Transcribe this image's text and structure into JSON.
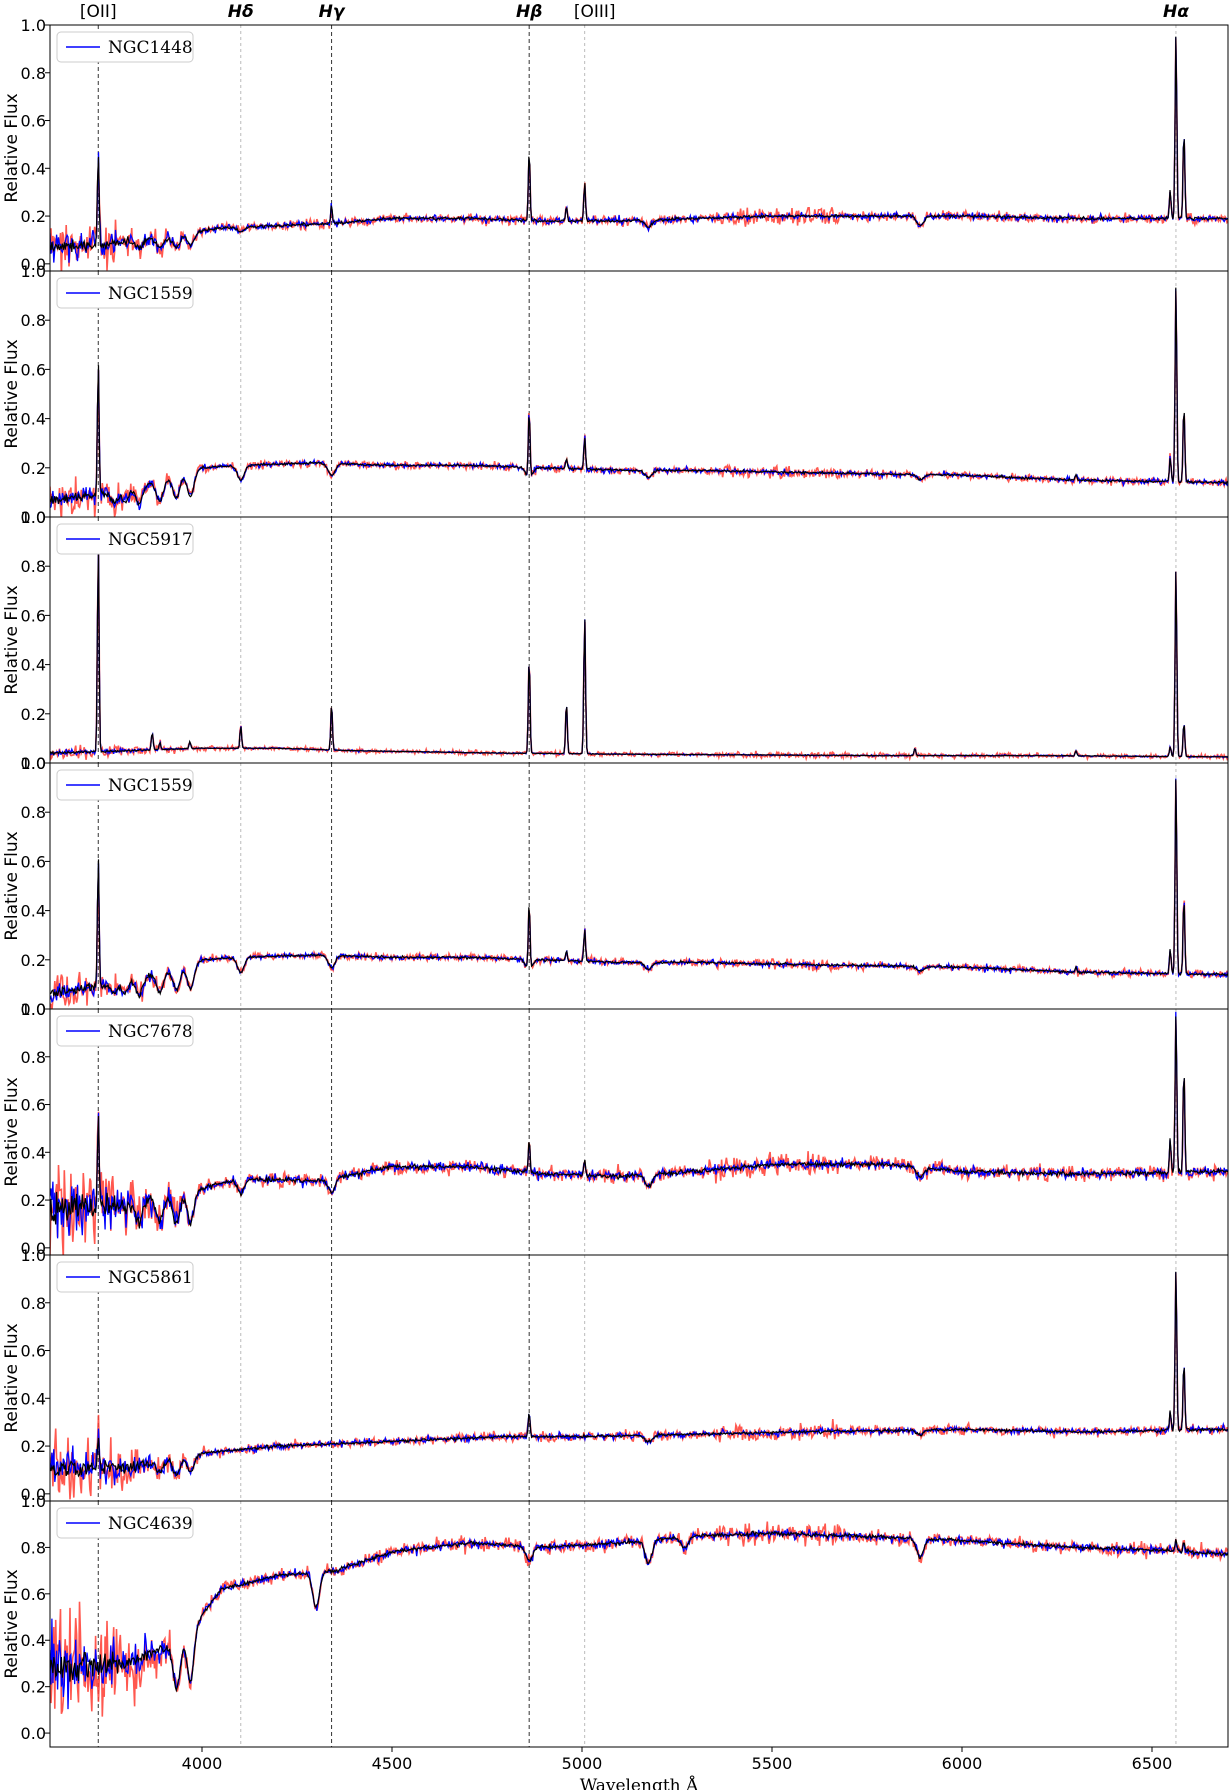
{
  "chart_data": {
    "type": "line",
    "xlabel": "Wavelength Å",
    "ylabel": "Relative Flux",
    "xlim": [
      3600,
      6700
    ],
    "x_ticks": [
      4000,
      4500,
      5000,
      5500,
      6000,
      6500
    ],
    "y_ticks": [
      0.0,
      0.2,
      0.4,
      0.6,
      0.8,
      1.0
    ],
    "y_tick_labels": [
      "0.0",
      "0.2",
      "0.4",
      "0.6",
      "0.8",
      "1.0"
    ],
    "grid": false,
    "legend_position": "upper-left",
    "colors": {
      "error_band": "#ff3b30",
      "model": "#0000ff",
      "observed": "#000000",
      "line_marker": "#555555"
    },
    "spectral_lines": [
      {
        "label": "[OII]",
        "wavelength": 3727,
        "style": "dashed-dark",
        "italic": false
      },
      {
        "label": "Hδ",
        "wavelength": 4102,
        "style": "dotted-light",
        "italic": true
      },
      {
        "label": "Hγ",
        "wavelength": 4341,
        "style": "dashed-dark",
        "italic": true
      },
      {
        "label": "Hβ",
        "wavelength": 4861,
        "style": "dashed-dark",
        "italic": true
      },
      {
        "label": "[OIII]",
        "wavelength": 5007,
        "style": "dotted-light",
        "italic": false
      },
      {
        "label": "Hα",
        "wavelength": 6563,
        "style": "dotted-light",
        "italic": true
      }
    ],
    "panels": [
      {
        "name": "NGC1448",
        "ylim": [
          -0.03,
          1.0
        ],
        "continuum": [
          [
            3600,
            0.07
          ],
          [
            3730,
            0.08
          ],
          [
            3900,
            0.11
          ],
          [
            4050,
            0.15
          ],
          [
            4200,
            0.16
          ],
          [
            4350,
            0.17
          ],
          [
            4500,
            0.19
          ],
          [
            4700,
            0.19
          ],
          [
            4900,
            0.18
          ],
          [
            5100,
            0.18
          ],
          [
            5300,
            0.19
          ],
          [
            5500,
            0.2
          ],
          [
            5800,
            0.2
          ],
          [
            6000,
            0.2
          ],
          [
            6300,
            0.19
          ],
          [
            6700,
            0.19
          ]
        ],
        "emission": [
          [
            3727,
            0.38
          ],
          [
            4341,
            0.08
          ],
          [
            4861,
            0.3
          ],
          [
            4959,
            0.06
          ],
          [
            5007,
            0.16
          ],
          [
            6548,
            0.12
          ],
          [
            6563,
            0.78
          ],
          [
            6584,
            0.37
          ]
        ],
        "absorption": [
          [
            3835,
            0.03
          ],
          [
            3889,
            0.04
          ],
          [
            3933,
            0.05
          ],
          [
            3970,
            0.05
          ],
          [
            4102,
            0.02
          ],
          [
            5175,
            0.03
          ],
          [
            5890,
            0.04
          ]
        ],
        "noise_base": 0.025,
        "noise_blue": 0.07,
        "band_width": 0.02,
        "band_red_only": 0.02
      },
      {
        "name": "NGC1559",
        "ylim": [
          0.0,
          1.0
        ],
        "continuum": [
          [
            3600,
            0.07
          ],
          [
            3730,
            0.09
          ],
          [
            3900,
            0.15
          ],
          [
            4000,
            0.2
          ],
          [
            4100,
            0.21
          ],
          [
            4300,
            0.22
          ],
          [
            4500,
            0.21
          ],
          [
            4700,
            0.21
          ],
          [
            4900,
            0.2
          ],
          [
            5100,
            0.19
          ],
          [
            5300,
            0.19
          ],
          [
            5600,
            0.18
          ],
          [
            6000,
            0.17
          ],
          [
            6300,
            0.15
          ],
          [
            6700,
            0.14
          ]
        ],
        "emission": [
          [
            3727,
            0.53
          ],
          [
            4861,
            0.27
          ],
          [
            4959,
            0.04
          ],
          [
            5007,
            0.13
          ],
          [
            6548,
            0.1
          ],
          [
            6563,
            0.81
          ],
          [
            6584,
            0.31
          ],
          [
            6300,
            0.02
          ]
        ],
        "absorption": [
          [
            3770,
            0.04
          ],
          [
            3798,
            0.05
          ],
          [
            3835,
            0.07
          ],
          [
            3889,
            0.08
          ],
          [
            3933,
            0.09
          ],
          [
            3970,
            0.1
          ],
          [
            4102,
            0.06
          ],
          [
            4341,
            0.05
          ],
          [
            4861,
            0.04
          ],
          [
            5175,
            0.03
          ],
          [
            5890,
            0.02
          ]
        ],
        "noise_base": 0.02,
        "noise_blue": 0.05,
        "band_width": 0.015,
        "band_red_only": 0.01
      },
      {
        "name": "NGC5917",
        "ylim": [
          0.0,
          1.0
        ],
        "continuum": [
          [
            3600,
            0.04
          ],
          [
            3800,
            0.05
          ],
          [
            4000,
            0.06
          ],
          [
            4200,
            0.06
          ],
          [
            4400,
            0.05
          ],
          [
            4800,
            0.04
          ],
          [
            5200,
            0.035
          ],
          [
            5800,
            0.03
          ],
          [
            6200,
            0.03
          ],
          [
            6700,
            0.025
          ]
        ],
        "emission": [
          [
            3727,
            0.84
          ],
          [
            3869,
            0.07
          ],
          [
            3889,
            0.03
          ],
          [
            3968,
            0.03
          ],
          [
            4102,
            0.09
          ],
          [
            4341,
            0.19
          ],
          [
            4861,
            0.39
          ],
          [
            4959,
            0.21
          ],
          [
            5007,
            0.56
          ],
          [
            5876,
            0.03
          ],
          [
            6300,
            0.02
          ],
          [
            6548,
            0.04
          ],
          [
            6563,
            0.77
          ],
          [
            6584,
            0.14
          ],
          [
            6717,
            0.02
          ]
        ],
        "absorption": [],
        "noise_base": 0.006,
        "noise_blue": 0.015,
        "band_width": 0.01,
        "band_red_only": 0.005
      },
      {
        "name": "NGC1559",
        "ylim": [
          0.0,
          1.0
        ],
        "continuum": [
          [
            3600,
            0.07
          ],
          [
            3730,
            0.09
          ],
          [
            3900,
            0.15
          ],
          [
            4000,
            0.2
          ],
          [
            4100,
            0.21
          ],
          [
            4300,
            0.22
          ],
          [
            4500,
            0.21
          ],
          [
            4700,
            0.21
          ],
          [
            4900,
            0.2
          ],
          [
            5100,
            0.19
          ],
          [
            5300,
            0.19
          ],
          [
            5600,
            0.18
          ],
          [
            6000,
            0.17
          ],
          [
            6300,
            0.15
          ],
          [
            6700,
            0.14
          ]
        ],
        "emission": [
          [
            3727,
            0.53
          ],
          [
            4861,
            0.27
          ],
          [
            4959,
            0.04
          ],
          [
            5007,
            0.13
          ],
          [
            6548,
            0.1
          ],
          [
            6563,
            0.81
          ],
          [
            6584,
            0.31
          ],
          [
            6300,
            0.02
          ]
        ],
        "absorption": [
          [
            3770,
            0.04
          ],
          [
            3798,
            0.05
          ],
          [
            3835,
            0.07
          ],
          [
            3889,
            0.08
          ],
          [
            3933,
            0.09
          ],
          [
            3970,
            0.1
          ],
          [
            4102,
            0.06
          ],
          [
            4341,
            0.05
          ],
          [
            4861,
            0.04
          ],
          [
            5175,
            0.03
          ],
          [
            5890,
            0.02
          ]
        ],
        "noise_base": 0.02,
        "noise_blue": 0.05,
        "band_width": 0.015,
        "band_red_only": 0.01
      },
      {
        "name": "NGC7678",
        "ylim": [
          -0.03,
          1.0
        ],
        "continuum": [
          [
            3600,
            0.16
          ],
          [
            3800,
            0.18
          ],
          [
            4000,
            0.25
          ],
          [
            4100,
            0.29
          ],
          [
            4300,
            0.28
          ],
          [
            4500,
            0.34
          ],
          [
            4700,
            0.34
          ],
          [
            4900,
            0.31
          ],
          [
            5100,
            0.3
          ],
          [
            5300,
            0.32
          ],
          [
            5500,
            0.35
          ],
          [
            5800,
            0.35
          ],
          [
            6000,
            0.32
          ],
          [
            6300,
            0.31
          ],
          [
            6700,
            0.32
          ]
        ],
        "emission": [
          [
            3727,
            0.4
          ],
          [
            4861,
            0.14
          ],
          [
            5007,
            0.06
          ],
          [
            6548,
            0.14
          ],
          [
            6563,
            0.67
          ],
          [
            6584,
            0.44
          ]
        ],
        "absorption": [
          [
            3835,
            0.08
          ],
          [
            3889,
            0.1
          ],
          [
            3933,
            0.12
          ],
          [
            3970,
            0.13
          ],
          [
            4102,
            0.06
          ],
          [
            4341,
            0.06
          ],
          [
            5175,
            0.05
          ],
          [
            5890,
            0.04
          ]
        ],
        "noise_base": 0.04,
        "noise_blue": 0.16,
        "band_width": 0.03,
        "band_red_only": 0.03
      },
      {
        "name": "NGC5861",
        "ylim": [
          -0.03,
          1.0
        ],
        "continuum": [
          [
            3600,
            0.1
          ],
          [
            3800,
            0.11
          ],
          [
            4000,
            0.17
          ],
          [
            4200,
            0.2
          ],
          [
            4500,
            0.22
          ],
          [
            4800,
            0.24
          ],
          [
            5000,
            0.24
          ],
          [
            5300,
            0.25
          ],
          [
            5600,
            0.26
          ],
          [
            6000,
            0.27
          ],
          [
            6300,
            0.26
          ],
          [
            6700,
            0.27
          ]
        ],
        "emission": [
          [
            3727,
            0.14
          ],
          [
            4861,
            0.1
          ],
          [
            6548,
            0.08
          ],
          [
            6563,
            0.68
          ],
          [
            6584,
            0.29
          ]
        ],
        "absorption": [
          [
            3889,
            0.05
          ],
          [
            3933,
            0.07
          ],
          [
            3970,
            0.07
          ],
          [
            5175,
            0.03
          ],
          [
            5890,
            0.02
          ]
        ],
        "noise_base": 0.025,
        "noise_blue": 0.11,
        "band_width": 0.02,
        "band_red_only": 0.02
      },
      {
        "name": "NGC4639",
        "ylim": [
          -0.06,
          1.0
        ],
        "continuum": [
          [
            3600,
            0.28
          ],
          [
            3800,
            0.3
          ],
          [
            3950,
            0.4
          ],
          [
            4050,
            0.62
          ],
          [
            4200,
            0.68
          ],
          [
            4350,
            0.7
          ],
          [
            4500,
            0.78
          ],
          [
            4700,
            0.82
          ],
          [
            4900,
            0.8
          ],
          [
            5100,
            0.82
          ],
          [
            5300,
            0.85
          ],
          [
            5500,
            0.86
          ],
          [
            5700,
            0.85
          ],
          [
            6000,
            0.83
          ],
          [
            6300,
            0.8
          ],
          [
            6500,
            0.79
          ],
          [
            6700,
            0.77
          ]
        ],
        "emission": [
          [
            6563,
            0.05
          ],
          [
            6584,
            0.04
          ]
        ],
        "absorption": [
          [
            3933,
            0.2
          ],
          [
            3970,
            0.22
          ],
          [
            4300,
            0.15
          ],
          [
            4861,
            0.06
          ],
          [
            5175,
            0.1
          ],
          [
            5270,
            0.05
          ],
          [
            5890,
            0.08
          ]
        ],
        "noise_base": 0.035,
        "noise_blue": 0.2,
        "band_width": 0.03,
        "band_red_only": 0.02
      }
    ]
  }
}
